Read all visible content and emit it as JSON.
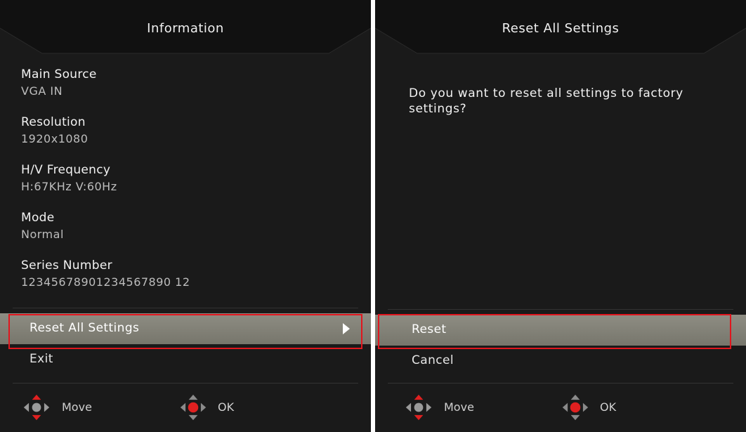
{
  "left": {
    "title": "Information",
    "info": [
      {
        "label": "Main Source",
        "value": "VGA IN"
      },
      {
        "label": "Resolution",
        "value": "1920x1080"
      },
      {
        "label": "H/V Frequency",
        "value": "H:67KHz V:60Hz"
      },
      {
        "label": "Mode",
        "value": "Normal"
      },
      {
        "label": "Series Number",
        "value": "12345678901234567890 12"
      }
    ],
    "menu": [
      {
        "label": "Reset All Settings",
        "selected": true
      },
      {
        "label": "Exit",
        "selected": false
      }
    ],
    "footer": {
      "move_label": "Move",
      "ok_label": "OK"
    }
  },
  "right": {
    "title": "Reset All Settings",
    "prompt": "Do you want to reset all settings to factory settings?",
    "menu": [
      {
        "label": "Reset",
        "selected": true
      },
      {
        "label": "Cancel",
        "selected": false
      }
    ],
    "footer": {
      "move_label": "Move",
      "ok_label": "OK"
    }
  },
  "colors": {
    "panel_bg": "#1a1a1a",
    "selected_row": "#85847a",
    "highlight_box": "#e0161e",
    "joystick_red": "#e02020"
  }
}
